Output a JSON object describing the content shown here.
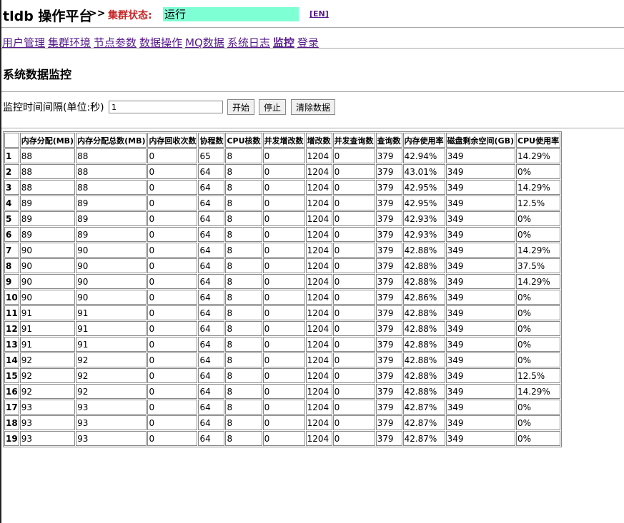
{
  "header": {
    "app_title": "tldb 操作平台",
    "arrows": ">>",
    "status_label": "集群状态:",
    "status_value": "运行",
    "lang_link": "[EN]"
  },
  "nav": [
    {
      "label": "用户管理"
    },
    {
      "label": "集群环境"
    },
    {
      "label": "节点参数"
    },
    {
      "label": "数据操作"
    },
    {
      "label": "MQ数据"
    },
    {
      "label": "系统日志"
    },
    {
      "label": "监控",
      "active": true
    },
    {
      "label": "登录"
    }
  ],
  "page": {
    "title": "系统数据监控"
  },
  "controls": {
    "interval_label": "监控时间间隔(单位:秒)",
    "interval_value": "1",
    "start_label": "开始",
    "stop_label": "停止",
    "clear_label": "清除数据"
  },
  "table": {
    "headers": [
      "",
      "内存分配(MB)",
      "内存分配总数(MB)",
      "内存回收次数",
      "协程数",
      "CPU核数",
      "并发增改数",
      "增改数",
      "并发查询数",
      "查询数",
      "内存使用率",
      "磁盘剩余空间(GB)",
      "CPU使用率"
    ],
    "rows": [
      [
        "1",
        "88",
        "88",
        "0",
        "65",
        "8",
        "0",
        "1204",
        "0",
        "379",
        "42.94%",
        "349",
        "14.29%"
      ],
      [
        "2",
        "88",
        "88",
        "0",
        "64",
        "8",
        "0",
        "1204",
        "0",
        "379",
        "43.01%",
        "349",
        "0%"
      ],
      [
        "3",
        "88",
        "88",
        "0",
        "64",
        "8",
        "0",
        "1204",
        "0",
        "379",
        "42.95%",
        "349",
        "14.29%"
      ],
      [
        "4",
        "89",
        "89",
        "0",
        "64",
        "8",
        "0",
        "1204",
        "0",
        "379",
        "42.95%",
        "349",
        "12.5%"
      ],
      [
        "5",
        "89",
        "89",
        "0",
        "64",
        "8",
        "0",
        "1204",
        "0",
        "379",
        "42.93%",
        "349",
        "0%"
      ],
      [
        "6",
        "89",
        "89",
        "0",
        "64",
        "8",
        "0",
        "1204",
        "0",
        "379",
        "42.93%",
        "349",
        "0%"
      ],
      [
        "7",
        "90",
        "90",
        "0",
        "64",
        "8",
        "0",
        "1204",
        "0",
        "379",
        "42.88%",
        "349",
        "14.29%"
      ],
      [
        "8",
        "90",
        "90",
        "0",
        "64",
        "8",
        "0",
        "1204",
        "0",
        "379",
        "42.88%",
        "349",
        "37.5%"
      ],
      [
        "9",
        "90",
        "90",
        "0",
        "64",
        "8",
        "0",
        "1204",
        "0",
        "379",
        "42.88%",
        "349",
        "14.29%"
      ],
      [
        "10",
        "90",
        "90",
        "0",
        "64",
        "8",
        "0",
        "1204",
        "0",
        "379",
        "42.86%",
        "349",
        "0%"
      ],
      [
        "11",
        "91",
        "91",
        "0",
        "64",
        "8",
        "0",
        "1204",
        "0",
        "379",
        "42.88%",
        "349",
        "0%"
      ],
      [
        "12",
        "91",
        "91",
        "0",
        "64",
        "8",
        "0",
        "1204",
        "0",
        "379",
        "42.88%",
        "349",
        "0%"
      ],
      [
        "13",
        "91",
        "91",
        "0",
        "64",
        "8",
        "0",
        "1204",
        "0",
        "379",
        "42.88%",
        "349",
        "0%"
      ],
      [
        "14",
        "92",
        "92",
        "0",
        "64",
        "8",
        "0",
        "1204",
        "0",
        "379",
        "42.88%",
        "349",
        "0%"
      ],
      [
        "15",
        "92",
        "92",
        "0",
        "64",
        "8",
        "0",
        "1204",
        "0",
        "379",
        "42.88%",
        "349",
        "12.5%"
      ],
      [
        "16",
        "92",
        "92",
        "0",
        "64",
        "8",
        "0",
        "1204",
        "0",
        "379",
        "42.88%",
        "349",
        "14.29%"
      ],
      [
        "17",
        "93",
        "93",
        "0",
        "64",
        "8",
        "0",
        "1204",
        "0",
        "379",
        "42.87%",
        "349",
        "0%"
      ],
      [
        "18",
        "93",
        "93",
        "0",
        "64",
        "8",
        "0",
        "1204",
        "0",
        "379",
        "42.87%",
        "349",
        "0%"
      ],
      [
        "19",
        "93",
        "93",
        "0",
        "64",
        "8",
        "0",
        "1204",
        "0",
        "379",
        "42.87%",
        "349",
        "0%"
      ]
    ]
  }
}
